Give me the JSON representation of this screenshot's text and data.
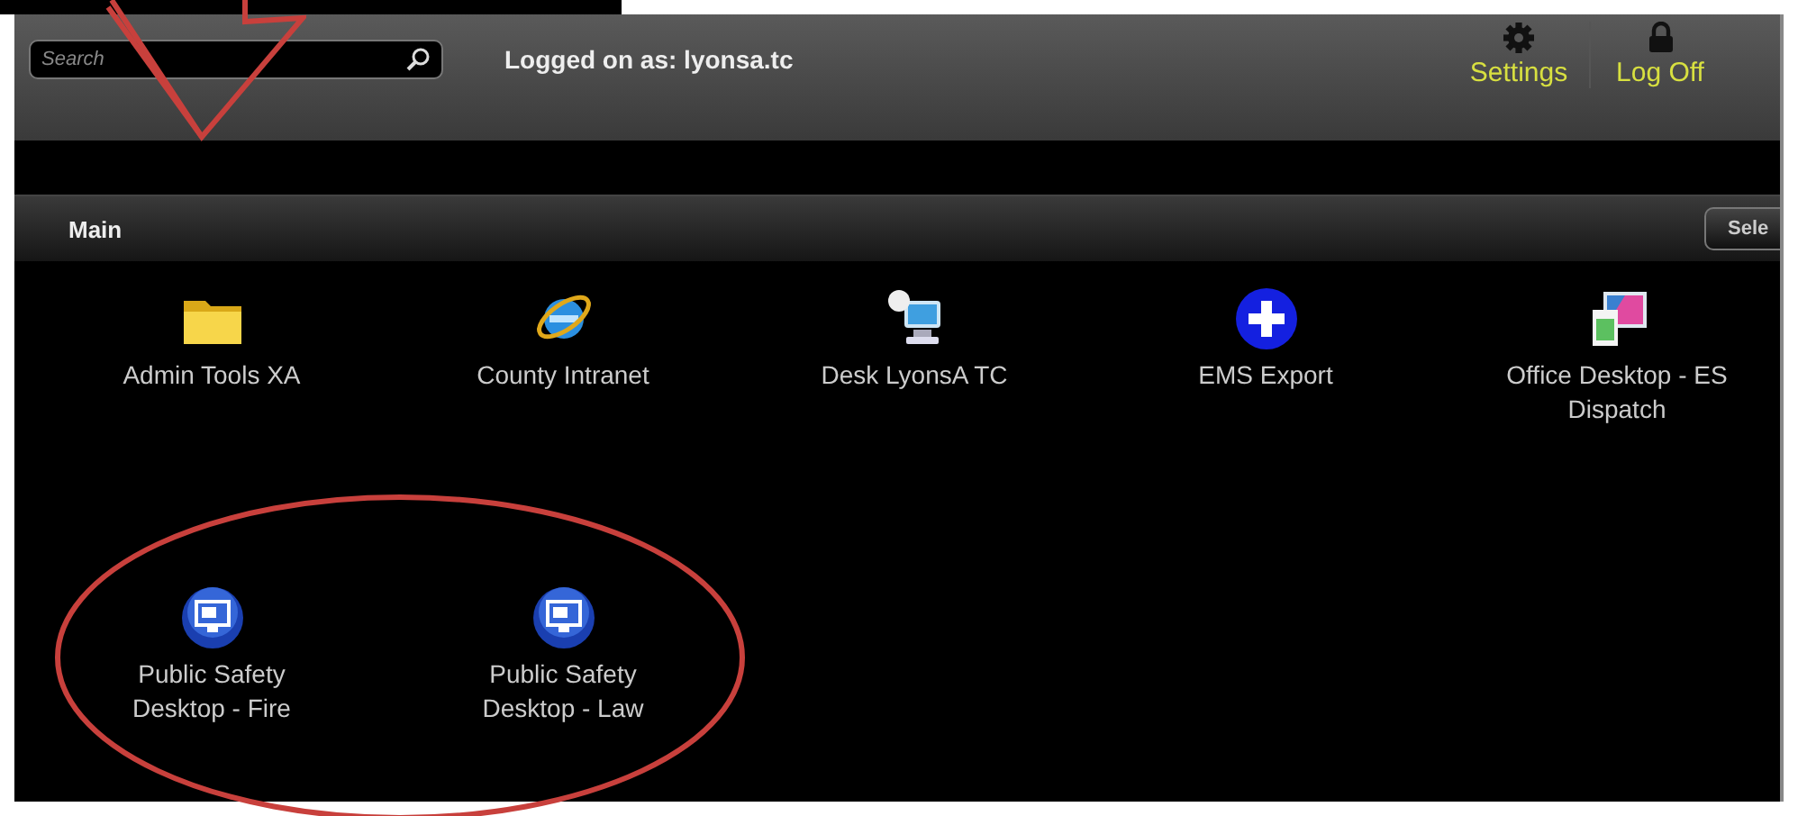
{
  "search": {
    "placeholder": "Search"
  },
  "user_label": "Logged on as: lyonsa.tc",
  "nav_buttons": [
    {
      "label": "Settings",
      "kind": "gear"
    },
    {
      "label": "Log Off",
      "kind": "lock"
    }
  ],
  "section": {
    "title": "Main",
    "button": "Sele"
  },
  "apps": [
    {
      "label": "Admin Tools XA",
      "kind": "folder"
    },
    {
      "label": "County Intranet",
      "kind": "browser"
    },
    {
      "label": "Desk LyonsA TC",
      "kind": "computer"
    },
    {
      "label": "EMS Export",
      "kind": "plus"
    },
    {
      "label": "Office Desktop - ES Dispatch",
      "kind": "display"
    },
    {
      "label": "Public Safety Desktop - Fire",
      "kind": "remote"
    },
    {
      "label": "Public Safety Desktop - Law",
      "kind": "remote"
    }
  ]
}
